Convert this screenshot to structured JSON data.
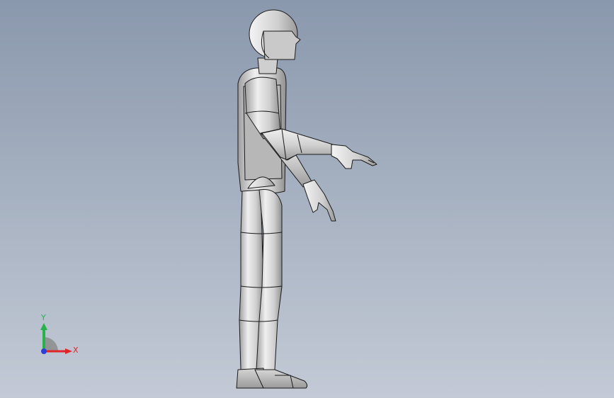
{
  "triad": {
    "x_label": "X",
    "y_label": "Y",
    "x_color": "#e0242a",
    "y_color": "#27b24a",
    "z_color": "#2d3fd6"
  },
  "colors": {
    "background_top": "#8a98ad",
    "background_bottom": "#c3cad6",
    "body_light": "#f2f2f2",
    "body_mid": "#bdbdbd",
    "body_dark": "#8e8e8e",
    "edge": "#1a1a1a"
  }
}
